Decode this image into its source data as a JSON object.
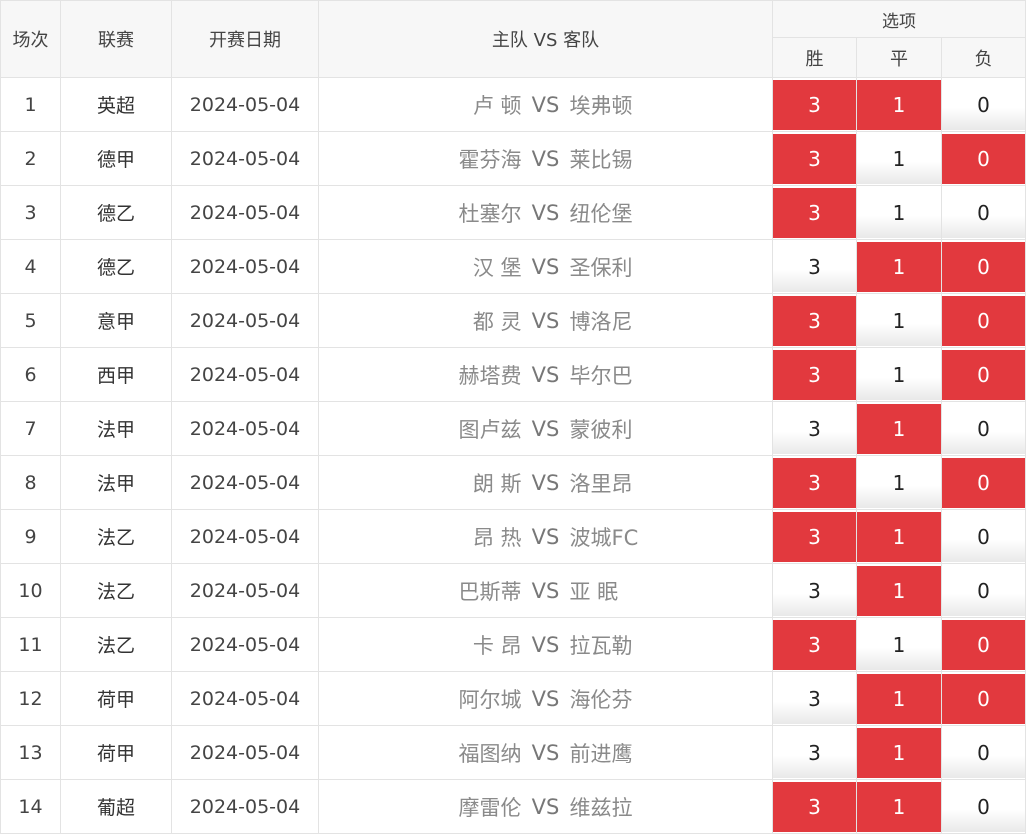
{
  "header": {
    "col_num": "场次",
    "col_league": "联赛",
    "col_date": "开赛日期",
    "col_teams": "主队 VS 客队",
    "col_options": "选项",
    "opt_win": "胜",
    "opt_draw": "平",
    "opt_loss": "负"
  },
  "colors": {
    "selected": "#e2393e",
    "unselected": "#ffffff"
  },
  "matches": [
    {
      "num": "1",
      "league": "英超",
      "date": "2024-05-04",
      "home": "卢 顿",
      "vs": "VS",
      "away": "埃弗顿",
      "win": "3",
      "draw": "1",
      "loss": "0",
      "sel": [
        true,
        true,
        false
      ]
    },
    {
      "num": "2",
      "league": "德甲",
      "date": "2024-05-04",
      "home": "霍芬海",
      "vs": "VS",
      "away": "莱比锡",
      "win": "3",
      "draw": "1",
      "loss": "0",
      "sel": [
        true,
        false,
        true
      ]
    },
    {
      "num": "3",
      "league": "德乙",
      "date": "2024-05-04",
      "home": "杜塞尔",
      "vs": "VS",
      "away": "纽伦堡",
      "win": "3",
      "draw": "1",
      "loss": "0",
      "sel": [
        true,
        false,
        false
      ]
    },
    {
      "num": "4",
      "league": "德乙",
      "date": "2024-05-04",
      "home": "汉 堡",
      "vs": "VS",
      "away": "圣保利",
      "win": "3",
      "draw": "1",
      "loss": "0",
      "sel": [
        false,
        true,
        true
      ]
    },
    {
      "num": "5",
      "league": "意甲",
      "date": "2024-05-04",
      "home": "都 灵",
      "vs": "VS",
      "away": "博洛尼",
      "win": "3",
      "draw": "1",
      "loss": "0",
      "sel": [
        true,
        false,
        true
      ]
    },
    {
      "num": "6",
      "league": "西甲",
      "date": "2024-05-04",
      "home": "赫塔费",
      "vs": "VS",
      "away": "毕尔巴",
      "win": "3",
      "draw": "1",
      "loss": "0",
      "sel": [
        true,
        false,
        true
      ]
    },
    {
      "num": "7",
      "league": "法甲",
      "date": "2024-05-04",
      "home": "图卢兹",
      "vs": "VS",
      "away": "蒙彼利",
      "win": "3",
      "draw": "1",
      "loss": "0",
      "sel": [
        false,
        true,
        false
      ]
    },
    {
      "num": "8",
      "league": "法甲",
      "date": "2024-05-04",
      "home": "朗 斯",
      "vs": "VS",
      "away": "洛里昂",
      "win": "3",
      "draw": "1",
      "loss": "0",
      "sel": [
        true,
        false,
        true
      ]
    },
    {
      "num": "9",
      "league": "法乙",
      "date": "2024-05-04",
      "home": "昂 热",
      "vs": "VS",
      "away": "波城FC",
      "win": "3",
      "draw": "1",
      "loss": "0",
      "sel": [
        true,
        true,
        false
      ]
    },
    {
      "num": "10",
      "league": "法乙",
      "date": "2024-05-04",
      "home": "巴斯蒂",
      "vs": "VS",
      "away": "亚 眠",
      "win": "3",
      "draw": "1",
      "loss": "0",
      "sel": [
        false,
        true,
        false
      ]
    },
    {
      "num": "11",
      "league": "法乙",
      "date": "2024-05-04",
      "home": "卡 昂",
      "vs": "VS",
      "away": "拉瓦勒",
      "win": "3",
      "draw": "1",
      "loss": "0",
      "sel": [
        true,
        false,
        true
      ]
    },
    {
      "num": "12",
      "league": "荷甲",
      "date": "2024-05-04",
      "home": "阿尔城",
      "vs": "VS",
      "away": "海伦芬",
      "win": "3",
      "draw": "1",
      "loss": "0",
      "sel": [
        false,
        true,
        true
      ]
    },
    {
      "num": "13",
      "league": "荷甲",
      "date": "2024-05-04",
      "home": "福图纳",
      "vs": "VS",
      "away": "前进鹰",
      "win": "3",
      "draw": "1",
      "loss": "0",
      "sel": [
        false,
        true,
        false
      ]
    },
    {
      "num": "14",
      "league": "葡超",
      "date": "2024-05-04",
      "home": "摩雷伦",
      "vs": "VS",
      "away": "维兹拉",
      "win": "3",
      "draw": "1",
      "loss": "0",
      "sel": [
        true,
        true,
        false
      ]
    }
  ]
}
